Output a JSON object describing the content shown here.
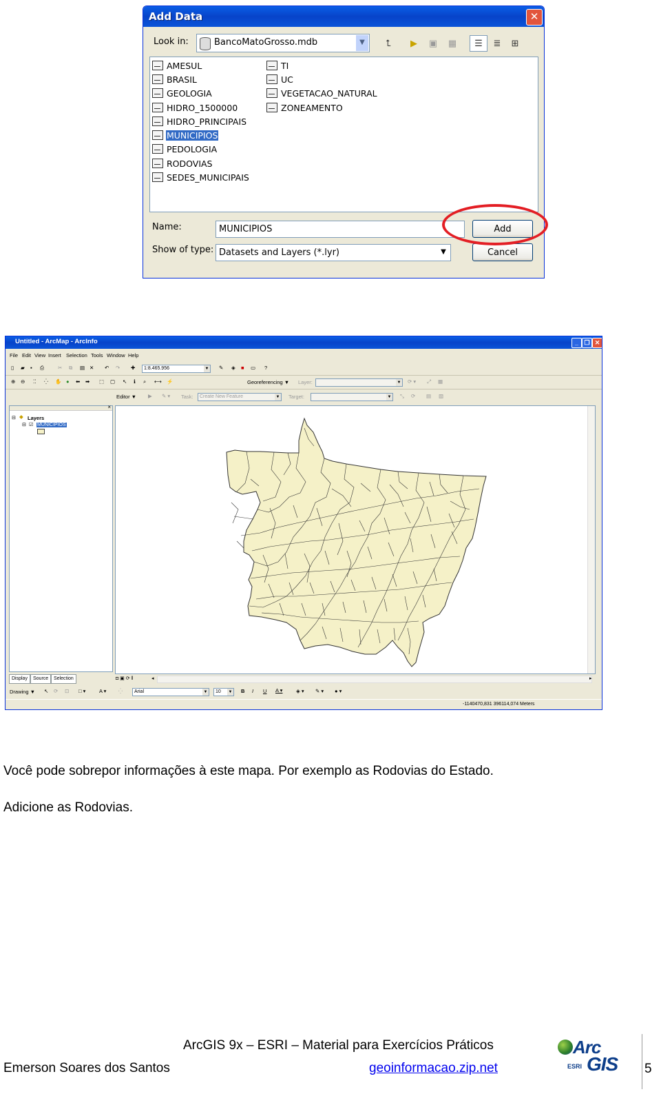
{
  "dialog": {
    "title": "Add Data",
    "close": "✕",
    "look_in_label": "Look in:",
    "look_in_value": "BancoMatoGrosso.mdb",
    "files_col1": [
      "AMESUL",
      "BRASIL",
      "GEOLOGIA",
      "HIDRO_1500000",
      "HIDRO_PRINCIPAIS",
      "MUNICIPIOS",
      "PEDOLOGIA",
      "RODOVIAS",
      "SEDES_MUNICIPAIS"
    ],
    "files_col2": [
      "TI",
      "UC",
      "VEGETACAO_NATURAL",
      "ZONEAMENTO"
    ],
    "selected_file": "MUNICIPIOS",
    "name_label": "Name:",
    "name_value": "MUNICIPIOS",
    "type_label": "Show of type:",
    "type_value": "Datasets and Layers (*.lyr)",
    "add_button": "Add",
    "cancel_button": "Cancel"
  },
  "arcmap": {
    "title": "Untitled - ArcMap - ArcInfo",
    "menu": [
      "File",
      "Edit",
      "View",
      "Insert",
      "Selection",
      "Tools",
      "Window",
      "Help"
    ],
    "scale": "1:8.465.956",
    "georeferencing": "Georeferencing ▼",
    "layer_label": "Layer:",
    "editor": "Editor ▼",
    "task_label": "Task:",
    "task_value": "Create New Feature",
    "target_label": "Target:",
    "toc": {
      "root": "Layers",
      "layer": "MUNICIPIOS"
    },
    "tabs": [
      "Display",
      "Source",
      "Selection"
    ],
    "drawing": "Drawing ▼",
    "font_name": "Arial",
    "font_size": "10",
    "status_coords": "-1140470,831  396114,074 Meters",
    "map_fill_color": "#F5F1C8",
    "map_line_color": "#333333"
  },
  "text": {
    "line1": "Você pode sobrepor informações à este mapa. Por exemplo as Rodovias do Estado.",
    "line2": "Adicione as Rodovias."
  },
  "footer": {
    "center_title": "ArcGIS 9x – ESRI – Material para Exercícios Práticos",
    "author": "Emerson Soares dos Santos",
    "site": "geoinformacao.zip.net",
    "page": "5",
    "logo_text": "ArcGIS",
    "logo_sub": "ESRI"
  }
}
